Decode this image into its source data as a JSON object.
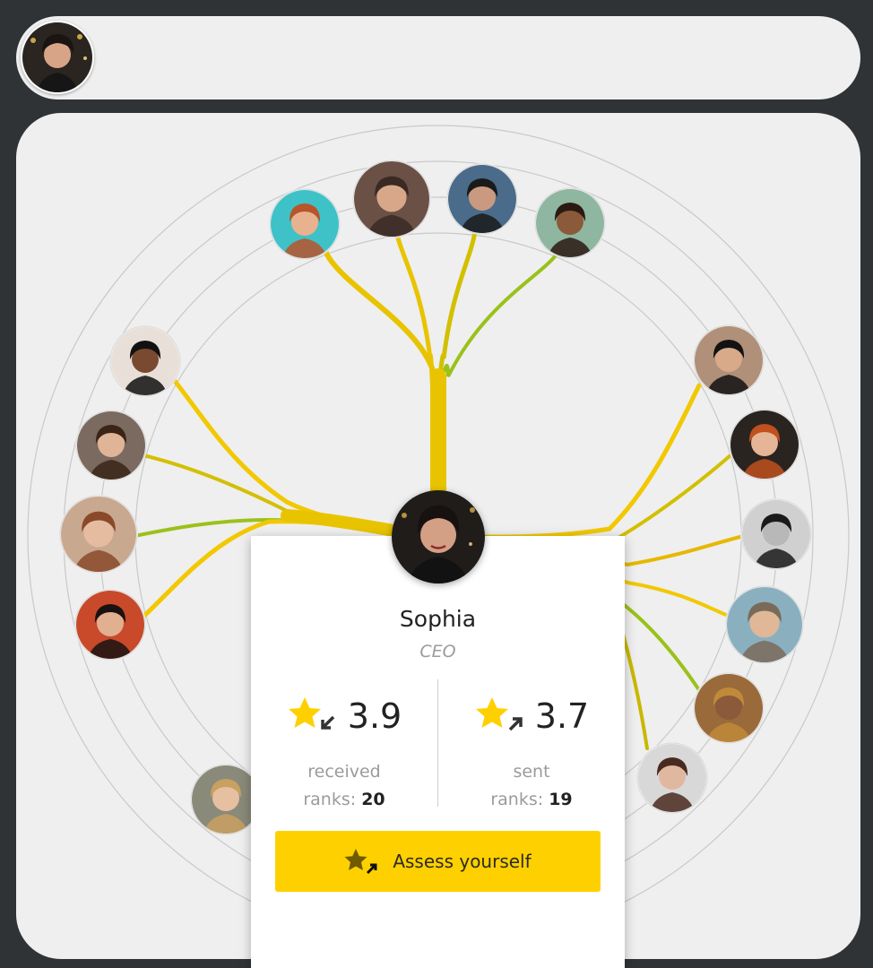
{
  "top_bar": {
    "avatar": "current-user-avatar"
  },
  "card": {
    "name": "Sophia",
    "role": "CEO",
    "received": {
      "value": "3.9",
      "label": "received",
      "ranks_label": "ranks:",
      "ranks": "20"
    },
    "sent": {
      "value": "3.7",
      "label": "sent",
      "ranks_label": "ranks:",
      "ranks": "19"
    },
    "assess_label": "Assess yourself"
  },
  "colors": {
    "accent": "#ffd000",
    "green": "#9bc11a",
    "panel": "#efefef",
    "frame": "#2f3336"
  }
}
